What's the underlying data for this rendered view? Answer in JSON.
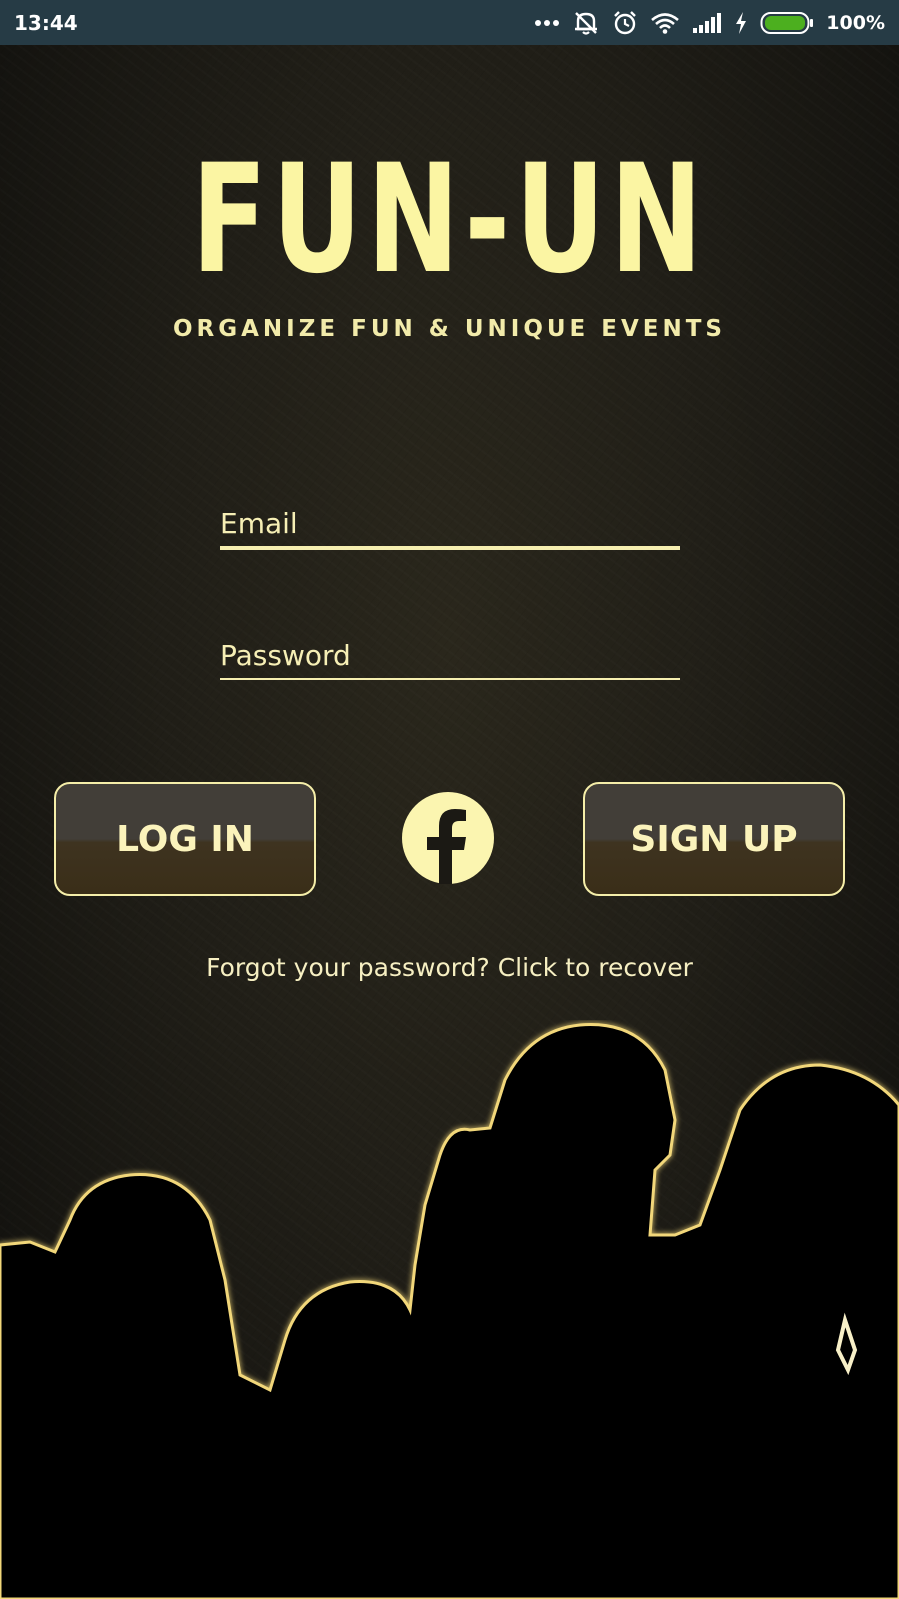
{
  "status_bar": {
    "time": "13:44",
    "battery_percent": "100%",
    "icons": [
      "more-dots-icon",
      "vibrate-icon",
      "alarm-icon",
      "wifi-icon",
      "signal-icon",
      "charging-icon",
      "battery-icon"
    ]
  },
  "app": {
    "logo_text": "FUN-UN",
    "tagline": "ORGANIZE FUN & UNIQUE EVENTS"
  },
  "form": {
    "email_placeholder": "Email",
    "email_value": "",
    "password_placeholder": "Password",
    "password_value": ""
  },
  "actions": {
    "login_label": "LOG IN",
    "signup_label": "SIGN UP",
    "facebook_icon": "facebook-icon",
    "forgot_text": "Forgot your password? Click to recover"
  },
  "colors": {
    "status_bar_bg": "#263b45",
    "accent": "#fbf5a3",
    "background": "#201e17",
    "battery_green": "#4caf1f"
  }
}
